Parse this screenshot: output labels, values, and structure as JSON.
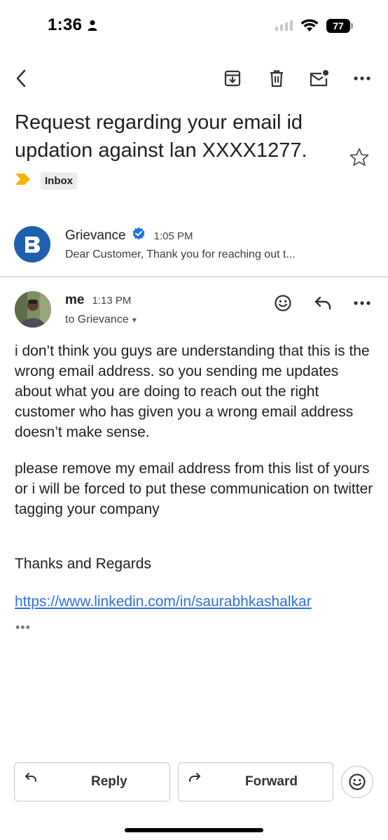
{
  "status_bar": {
    "time": "1:36",
    "battery": "77"
  },
  "subject": "Request regarding your email id updation against lan XXXX1277.",
  "label": "Inbox",
  "collapsed_message": {
    "sender": "Grievance",
    "time": "1:05 PM",
    "snippet": "Dear Customer, Thank you for reaching out t..."
  },
  "expanded_message": {
    "sender": "me",
    "time": "1:13 PM",
    "to": "to Grievance",
    "paragraphs": [
      "i don’t think you guys are understanding that this is the wrong email address. so you sending me updates about what you are doing to reach out the right customer who has given you a wrong email address doesn’t make sense.",
      "please remove my email address from this list of yours or i will be forced to put these communication on twitter tagging your company",
      "Thanks and Regards"
    ],
    "link": "https://www.linkedin.com/in/saurabhkashalkar",
    "trimmed": "•••"
  },
  "actions": {
    "reply": "Reply",
    "forward": "Forward"
  },
  "colors": {
    "accent_link": "#2f6fd9",
    "label_arrow": "#f4b400",
    "avatar_brand": "#1e5fae",
    "verified": "#1a73e8"
  }
}
